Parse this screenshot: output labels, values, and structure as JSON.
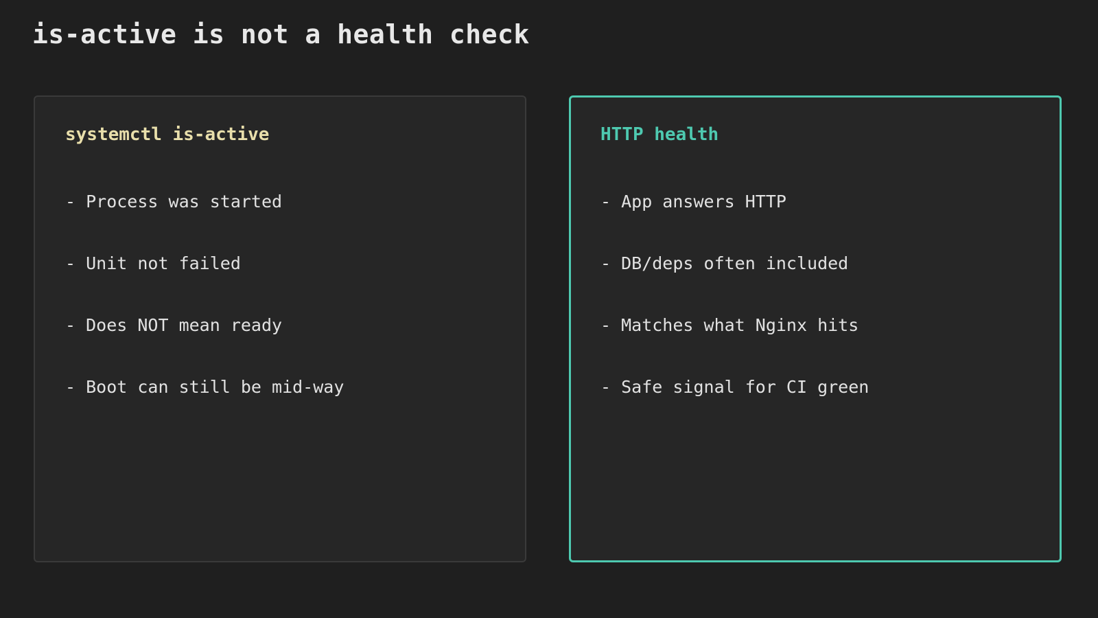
{
  "page": {
    "title": "is-active is not a health check"
  },
  "cards": [
    {
      "heading": "systemctl is-active",
      "items": [
        "- Process was started",
        "- Unit not failed",
        "- Does NOT mean ready",
        "- Boot can still be mid-way"
      ]
    },
    {
      "heading": "HTTP health",
      "items": [
        "- App answers HTTP",
        "- DB/deps often included",
        "- Matches what Nginx hits",
        "- Safe signal for CI green"
      ]
    }
  ],
  "colors": {
    "background": "#1f1f1f",
    "card_background": "#262626",
    "left_heading": "#e9dfab",
    "accent": "#4ec9b0",
    "text": "#e2e2e2"
  }
}
